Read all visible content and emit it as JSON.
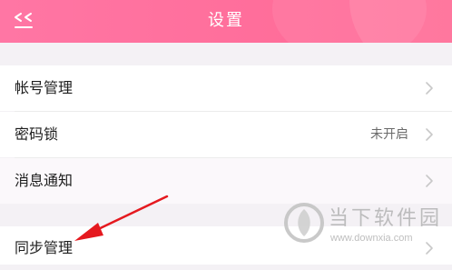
{
  "header": {
    "title": "设置",
    "back_icon": "double-chevron-left-icon",
    "background_color": "#ff6f9c"
  },
  "settings": {
    "items": [
      {
        "label": "帐号管理",
        "value": ""
      },
      {
        "label": "密码锁",
        "value": "未开启"
      },
      {
        "label": "消息通知",
        "value": ""
      },
      {
        "label": "同步管理",
        "value": ""
      }
    ]
  },
  "annotation": {
    "arrow_color": "#e5191f"
  },
  "watermark": {
    "name": "当下软件园",
    "url": "www.downxia.com"
  }
}
